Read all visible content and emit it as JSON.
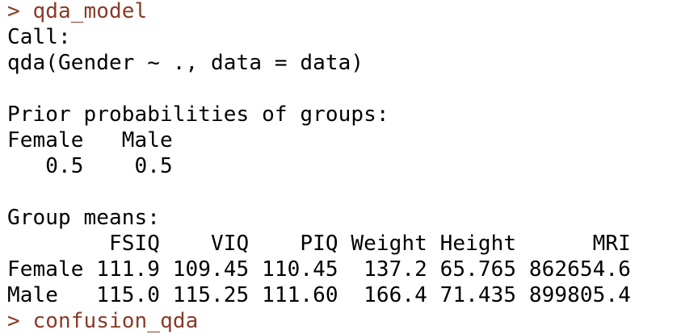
{
  "console": {
    "prompt_symbol": ">",
    "command_1": "qda_model",
    "output": [
      "Call:",
      "qda(Gender ~ ., data = data)",
      "",
      "Prior probabilities of groups:",
      "Female   Male ",
      "   0.5    0.5 ",
      "",
      "Group means:",
      "        FSIQ    VIQ    PIQ Weight Height      MRI",
      "Female 111.9 109.45 110.45  137.2 65.765 862654.6",
      "Male   115.0 115.25 111.60  166.4 71.435 899805.4"
    ],
    "command_2": "confusion_qda"
  },
  "colors": {
    "background": "#ffffff",
    "output_text": "#000000",
    "command_text": "#8a3a27"
  }
}
